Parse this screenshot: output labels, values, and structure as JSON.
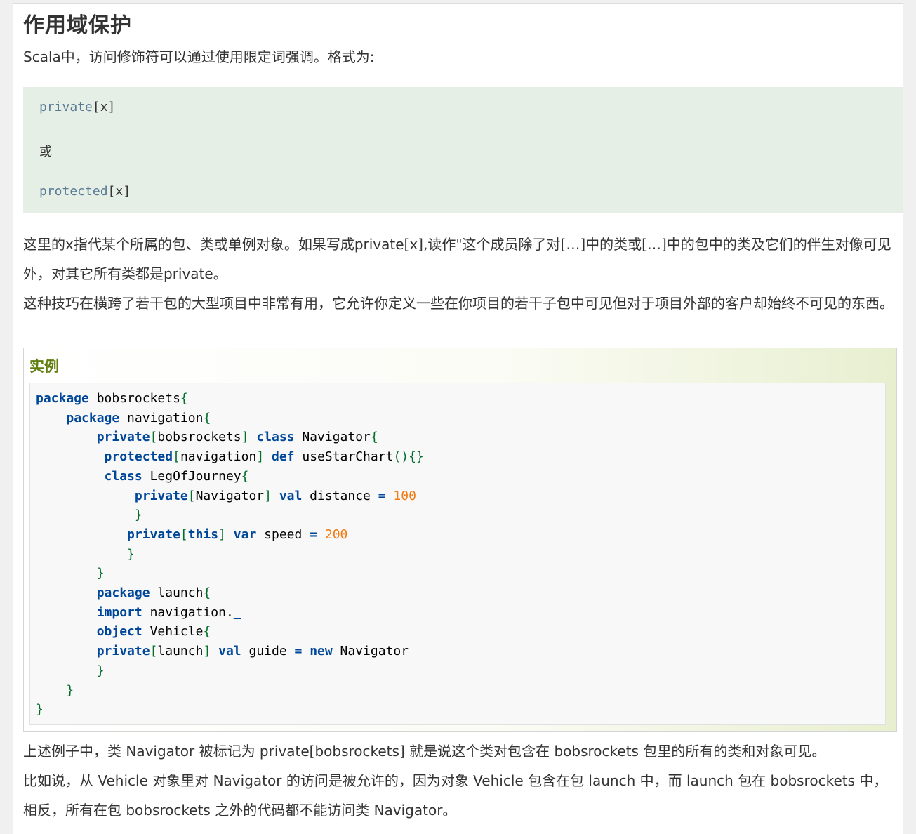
{
  "heading": "作用域保护",
  "intro": "Scala中，访问修饰符可以通过使用限定词强调。格式为:",
  "format_block": {
    "line1_kw": "private",
    "line1_rest": "[x]",
    "line2": "或",
    "line3_kw": "protected",
    "line3_rest": "[x]"
  },
  "explain1": "这里的x指代某个所属的包、类或单例对象。如果写成private[x],读作\"这个成员除了对[…]中的类或[…]中的包中的类及它们的伴生对像可见外，对其它所有类都是private。",
  "explain2": "这种技巧在横跨了若干包的大型项目中非常有用，它允许你定义一些在你项目的若干子包中可见但对于项目外部的客户却始终不可见的东西。",
  "example": {
    "title": "实例",
    "code": [
      [
        [
          "kw",
          "package"
        ],
        [
          "t",
          " bobsrockets"
        ],
        [
          "p",
          "{"
        ]
      ],
      [
        [
          "t",
          "    "
        ],
        [
          "kw",
          "package"
        ],
        [
          "t",
          " navigation"
        ],
        [
          "p",
          "{"
        ]
      ],
      [
        [
          "t",
          "        "
        ],
        [
          "kw",
          "private"
        ],
        [
          "p",
          "["
        ],
        [
          "t",
          "bobsrockets"
        ],
        [
          "p",
          "]"
        ],
        [
          "t",
          " "
        ],
        [
          "kw",
          "class"
        ],
        [
          "t",
          " Navigator"
        ],
        [
          "p",
          "{"
        ]
      ],
      [
        [
          "t",
          "         "
        ],
        [
          "kw",
          "protected"
        ],
        [
          "p",
          "["
        ],
        [
          "t",
          "navigation"
        ],
        [
          "p",
          "]"
        ],
        [
          "t",
          " "
        ],
        [
          "kw",
          "def"
        ],
        [
          "t",
          " useStarChart"
        ],
        [
          "p",
          "(){}"
        ]
      ],
      [
        [
          "t",
          "         "
        ],
        [
          "kw",
          "class"
        ],
        [
          "t",
          " LegOfJourney"
        ],
        [
          "p",
          "{"
        ]
      ],
      [
        [
          "t",
          "             "
        ],
        [
          "kw",
          "private"
        ],
        [
          "p",
          "["
        ],
        [
          "t",
          "Navigator"
        ],
        [
          "p",
          "]"
        ],
        [
          "t",
          " "
        ],
        [
          "kw",
          "val"
        ],
        [
          "t",
          " distance "
        ],
        [
          "kw",
          "="
        ],
        [
          "t",
          " "
        ],
        [
          "n",
          "100"
        ]
      ],
      [
        [
          "t",
          "             "
        ],
        [
          "p",
          "}"
        ]
      ],
      [
        [
          "t",
          "            "
        ],
        [
          "kw",
          "private"
        ],
        [
          "p",
          "["
        ],
        [
          "kw",
          "this"
        ],
        [
          "p",
          "]"
        ],
        [
          "t",
          " "
        ],
        [
          "kw",
          "var"
        ],
        [
          "t",
          " speed "
        ],
        [
          "kw",
          "="
        ],
        [
          "t",
          " "
        ],
        [
          "n",
          "200"
        ]
      ],
      [
        [
          "t",
          "            "
        ],
        [
          "p",
          "}"
        ]
      ],
      [
        [
          "t",
          "        "
        ],
        [
          "p",
          "}"
        ]
      ],
      [
        [
          "t",
          "        "
        ],
        [
          "kw",
          "package"
        ],
        [
          "t",
          " launch"
        ],
        [
          "p",
          "{"
        ]
      ],
      [
        [
          "t",
          "        "
        ],
        [
          "kw",
          "import"
        ],
        [
          "t",
          " navigation."
        ],
        [
          "kw",
          "_"
        ]
      ],
      [
        [
          "t",
          "        "
        ],
        [
          "kw",
          "object"
        ],
        [
          "t",
          " Vehicle"
        ],
        [
          "p",
          "{"
        ]
      ],
      [
        [
          "t",
          "        "
        ],
        [
          "kw",
          "private"
        ],
        [
          "p",
          "["
        ],
        [
          "t",
          "launch"
        ],
        [
          "p",
          "]"
        ],
        [
          "t",
          " "
        ],
        [
          "kw",
          "val"
        ],
        [
          "t",
          " guide "
        ],
        [
          "kw",
          "="
        ],
        [
          "t",
          " "
        ],
        [
          "kw",
          "new"
        ],
        [
          "t",
          " Navigator"
        ]
      ],
      [
        [
          "t",
          "        "
        ],
        [
          "p",
          "}"
        ]
      ],
      [
        [
          "t",
          "    "
        ],
        [
          "p",
          "}"
        ]
      ],
      [
        [
          "p",
          "}"
        ]
      ]
    ]
  },
  "after1": "上述例子中，类 Navigator 被标记为 private[bobsrockets] 就是说这个类对包含在 bobsrockets 包里的所有的类和对象可见。",
  "after2": "比如说，从 Vehicle 对象里对 Navigator 的访问是被允许的，因为对象 Vehicle 包含在包 launch 中，而 launch 包在 bobsrockets 中，相反，所有在包 bobsrockets 之外的代码都不能访问类 Navigator。"
}
